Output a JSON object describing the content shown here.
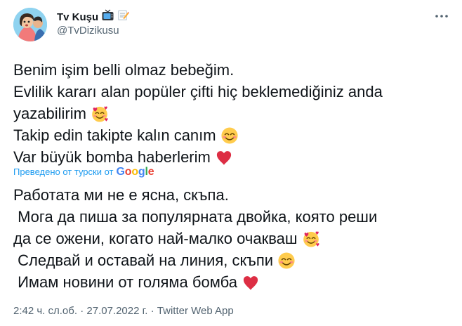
{
  "user": {
    "display_name": "Tv Kuşu",
    "handle": "@TvDizikusu",
    "name_emojis": [
      "tv-icon",
      "memo-icon"
    ]
  },
  "tweet": {
    "original_lines": [
      "Benim işim belli olmaz bebeğim.",
      "Evlilik kararı alan popüler çifti hiç beklemediğiniz anda",
      "yazabilirim",
      "Takip edin takipte kalın canım",
      "Var büyük bomba haberlerim"
    ],
    "translated_by": "Преведено от турски от",
    "translation_provider": "Google",
    "translated_lines": [
      "Работата ми не е ясна, скъпа.",
      " Мога да пиша за популярната двойка, която реши",
      "да се ожени, когато най-малко очакваш",
      " Следвай и оставай на линия, скъпи",
      " Имам новини от голяма бомба"
    ]
  },
  "meta": {
    "time": "2:42 ч. сл.об.",
    "date": "27.07.2022 г.",
    "source": "Twitter Web App",
    "separator": "·"
  },
  "icons": {
    "more": "more-options-icon",
    "love_face": "smiling-face-with-hearts-icon",
    "blush": "smiling-face-with-smiling-eyes-icon",
    "heart": "red-heart-icon"
  },
  "colors": {
    "text": "#0f1419",
    "secondary": "#536471",
    "link": "#1d9bf0",
    "heart": "#e0245e",
    "emoji_face": "#ffcc4d"
  }
}
